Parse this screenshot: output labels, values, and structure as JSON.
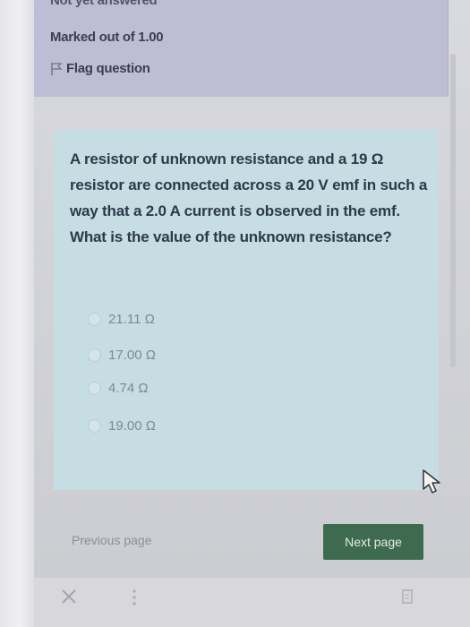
{
  "info": {
    "status": "Not yet answered",
    "marked": "Marked out of 1.00",
    "flag_label": "Flag question"
  },
  "question": {
    "text": "A resistor of unknown resistance and a 19 Ω resistor are connected across a 20 V emf in such a way that a 2.0 A current is observed in the emf. What is the value of the unknown resistance?"
  },
  "answers": [
    {
      "label": "21.11 Ω"
    },
    {
      "label": "17.00 Ω"
    },
    {
      "label": "4.74 Ω"
    },
    {
      "label": "19.00 Ω"
    }
  ],
  "nav": {
    "previous": "Previous page",
    "next": "Next page"
  },
  "icons": {
    "flag": "flag-icon",
    "close": "close-icon",
    "more": "more-vertical-icon",
    "cursor": "mouse-cursor-icon"
  },
  "colors": {
    "info_bg": "#bdbdd6",
    "question_bg": "#c6dde3",
    "next_button": "#3e6b4f"
  }
}
